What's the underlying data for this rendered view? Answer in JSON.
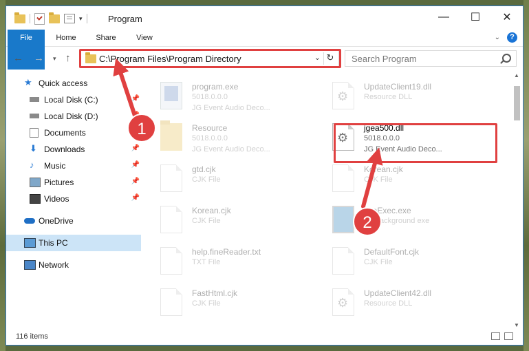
{
  "window": {
    "title": "Program"
  },
  "ribbon": {
    "tabs": [
      "File",
      "Home",
      "Share",
      "View"
    ]
  },
  "address": {
    "path": "C:\\Program Files\\Program Directory"
  },
  "search": {
    "placeholder": "Search Program"
  },
  "nav": {
    "items": [
      {
        "label": "Quick access",
        "icon": "star-icon"
      },
      {
        "label": "Local Disk (C:)",
        "icon": "drive-icon"
      },
      {
        "label": "Local Disk (D:)",
        "icon": "drive-icon"
      },
      {
        "label": "Documents",
        "icon": "documents-icon"
      },
      {
        "label": "Downloads",
        "icon": "download-icon"
      },
      {
        "label": "Music",
        "icon": "music-icon"
      },
      {
        "label": "Pictures",
        "icon": "pictures-icon"
      },
      {
        "label": "Videos",
        "icon": "videos-icon"
      },
      {
        "label": "OneDrive",
        "icon": "cloud-icon"
      },
      {
        "label": "This PC",
        "icon": "computer-icon"
      },
      {
        "label": "Network",
        "icon": "network-icon"
      }
    ]
  },
  "files": [
    {
      "name": "program.exe",
      "line1": "5018.0.0.0",
      "line2": "JG Event Audio Deco...",
      "icon": "exe-icon"
    },
    {
      "name": "UpdateClient19.dll",
      "line1": "Resource DLL",
      "line2": "",
      "icon": "dll-icon"
    },
    {
      "name": "Resource",
      "line1": "5018.0.0.0",
      "line2": "JG Event Audio Deco...",
      "icon": "folder-icon"
    },
    {
      "name": "jgea500.dll",
      "line1": "5018.0.0.0",
      "line2": "JG Event Audio Deco...",
      "icon": "dll-icon"
    },
    {
      "name": "gtd.cjk",
      "line1": "CJK File",
      "line2": "",
      "icon": "document-icon"
    },
    {
      "name": "Korean.cjk",
      "line1": "CJK File",
      "line2": "",
      "icon": "document-icon"
    },
    {
      "name": "Korean.cjk",
      "line1": "CJK File",
      "line2": "",
      "icon": "document-icon"
    },
    {
      "name": "fineExec.exe",
      "line1": "FY background exe",
      "line2": "",
      "icon": "exe-icon"
    },
    {
      "name": "help.fineReader.txt",
      "line1": "TXT File",
      "line2": "",
      "icon": "document-icon"
    },
    {
      "name": "DefaultFont.cjk",
      "line1": "CJK File",
      "line2": "",
      "icon": "document-icon"
    },
    {
      "name": "FastHtml.cjk",
      "line1": "CJK File",
      "line2": "",
      "icon": "document-icon"
    },
    {
      "name": "UpdateClient42.dll",
      "line1": "Resource DLL",
      "line2": "",
      "icon": "dll-icon"
    }
  ],
  "status": {
    "count": "116 items"
  },
  "annotations": {
    "step1": "1",
    "step2": "2"
  },
  "colors": {
    "accent": "#1979ca",
    "highlight": "#e04040",
    "selected": "#cce4f7"
  }
}
